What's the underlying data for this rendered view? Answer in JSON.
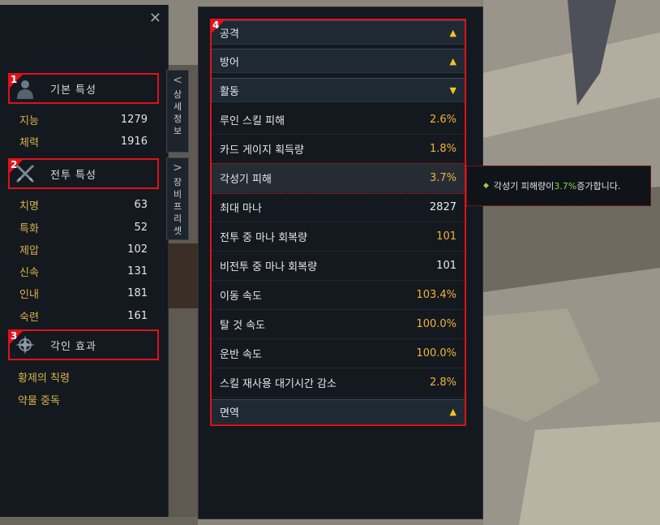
{
  "left": {
    "sections": {
      "basic": {
        "badge": "1",
        "title": "기본 특성"
      },
      "combat": {
        "badge": "2",
        "title": "전투 특성"
      },
      "engraving": {
        "badge": "3",
        "title": "각인 효과"
      }
    },
    "basic_stats": [
      {
        "label": "지능",
        "value": "1279"
      },
      {
        "label": "체력",
        "value": "1916"
      }
    ],
    "combat_stats": [
      {
        "label": "치명",
        "value": "63"
      },
      {
        "label": "특화",
        "value": "52"
      },
      {
        "label": "제압",
        "value": "102"
      },
      {
        "label": "신속",
        "value": "131"
      },
      {
        "label": "인내",
        "value": "181"
      },
      {
        "label": "숙련",
        "value": "161"
      }
    ],
    "engravings": [
      "황제의 칙령",
      "약물 중독"
    ],
    "side_tabs": {
      "detail": [
        "상",
        "세",
        "정",
        "보"
      ],
      "preset": [
        "장",
        "비",
        "프",
        "리",
        "셋"
      ]
    }
  },
  "main": {
    "badge": "4",
    "categories": {
      "attack": {
        "label": "공격",
        "arrow": "up"
      },
      "defense": {
        "label": "방어",
        "arrow": "up"
      },
      "activity": {
        "label": "활동",
        "arrow": "down"
      },
      "immunity": {
        "label": "면역",
        "arrow": "up"
      }
    },
    "activity_rows": [
      {
        "label": "루인 스킬 피해",
        "value": "2.6%",
        "color": "#f0b33c"
      },
      {
        "label": "카드 게이지 획득량",
        "value": "1.8%",
        "color": "#f0b33c"
      },
      {
        "label": "각성기 피해",
        "value": "3.7%",
        "color": "#f0b33c"
      },
      {
        "label": "최대 마나",
        "value": "2827",
        "color": "#e8eaed"
      },
      {
        "label": "전투 중 마나 회복량",
        "value": "101",
        "color": "#e8eaed"
      },
      {
        "label": "비전투 중 마나 회복량",
        "value": "101",
        "color": "#e8eaed"
      },
      {
        "label": "이동 속도",
        "value": "103.4%",
        "color": "#f0b33c"
      },
      {
        "label": "탈 것 속도",
        "value": "100.0%",
        "color": "#f0b33c"
      },
      {
        "label": "운반 속도",
        "value": "100.0%",
        "color": "#f0b33c"
      },
      {
        "label": "스킬 재사용 대기시간 감소",
        "value": "2.8%",
        "color": "#f0b33c"
      }
    ]
  },
  "tooltip": {
    "prefix": "각성기 피해량이 ",
    "value": "3.7%",
    "suffix": " 증가합니다."
  },
  "colors": {
    "accent_red": "#e0121a",
    "stat_gold": "#d9b34a",
    "value_orange": "#f0b33c",
    "arrow_yellow": "#f2c51c"
  }
}
